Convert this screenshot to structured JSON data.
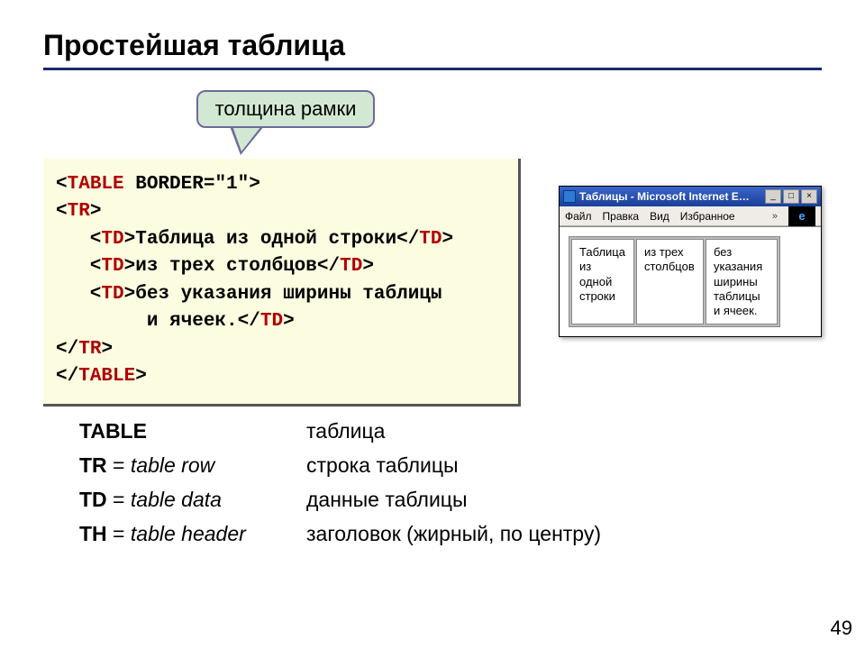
{
  "title": "Простейшая таблица",
  "callout": "толщина рамки",
  "code": {
    "l1a": "<",
    "l1b": "TABLE",
    "l1c": " BORDER=\"1\">",
    "l2a": "<",
    "l2b": "TR",
    "l2c": ">",
    "l3a": "   <",
    "l3b": "TD",
    "l3c": ">Таблица из одной строки</",
    "l3d": "TD",
    "l3e": ">",
    "l4a": "   <",
    "l4b": "TD",
    "l4c": ">из трех столбцов</",
    "l4d": "TD",
    "l4e": ">",
    "l5a": "   <",
    "l5b": "TD",
    "l5c": ">без указания ширины таблицы",
    "l6": "        и ячеек.</",
    "l6b": "TD",
    "l6c": ">",
    "l7a": "</",
    "l7b": "TR",
    "l7c": ">",
    "l8a": "</",
    "l8b": "TABLE",
    "l8c": ">"
  },
  "browser": {
    "title": "Таблицы - Microsoft Internet E…",
    "menu": {
      "file": "Файл",
      "edit": "Правка",
      "view": "Вид",
      "fav": "Избранное",
      "more": "»"
    },
    "cells": {
      "c1": "Таблица из одной строки",
      "c2": "из трех столбцов",
      "c3": "без указания ширины таблицы и ячеек."
    },
    "win_btns": {
      "min": "_",
      "max": "□",
      "close": "×"
    },
    "logo_glyph": "e"
  },
  "defs": {
    "r1": {
      "l": "TABLE",
      "r": "таблица"
    },
    "r2": {
      "lb": "TR",
      "le": " = ",
      "li": "table row",
      "r": "строка таблицы"
    },
    "r3": {
      "lb": "TD",
      "le": " = ",
      "li": "table data",
      "r": "данные таблицы"
    },
    "r4": {
      "lb": "TH",
      "le": " = ",
      "li": "table header",
      "r": "заголовок (жирный, по центру)"
    }
  },
  "page_number": "49"
}
